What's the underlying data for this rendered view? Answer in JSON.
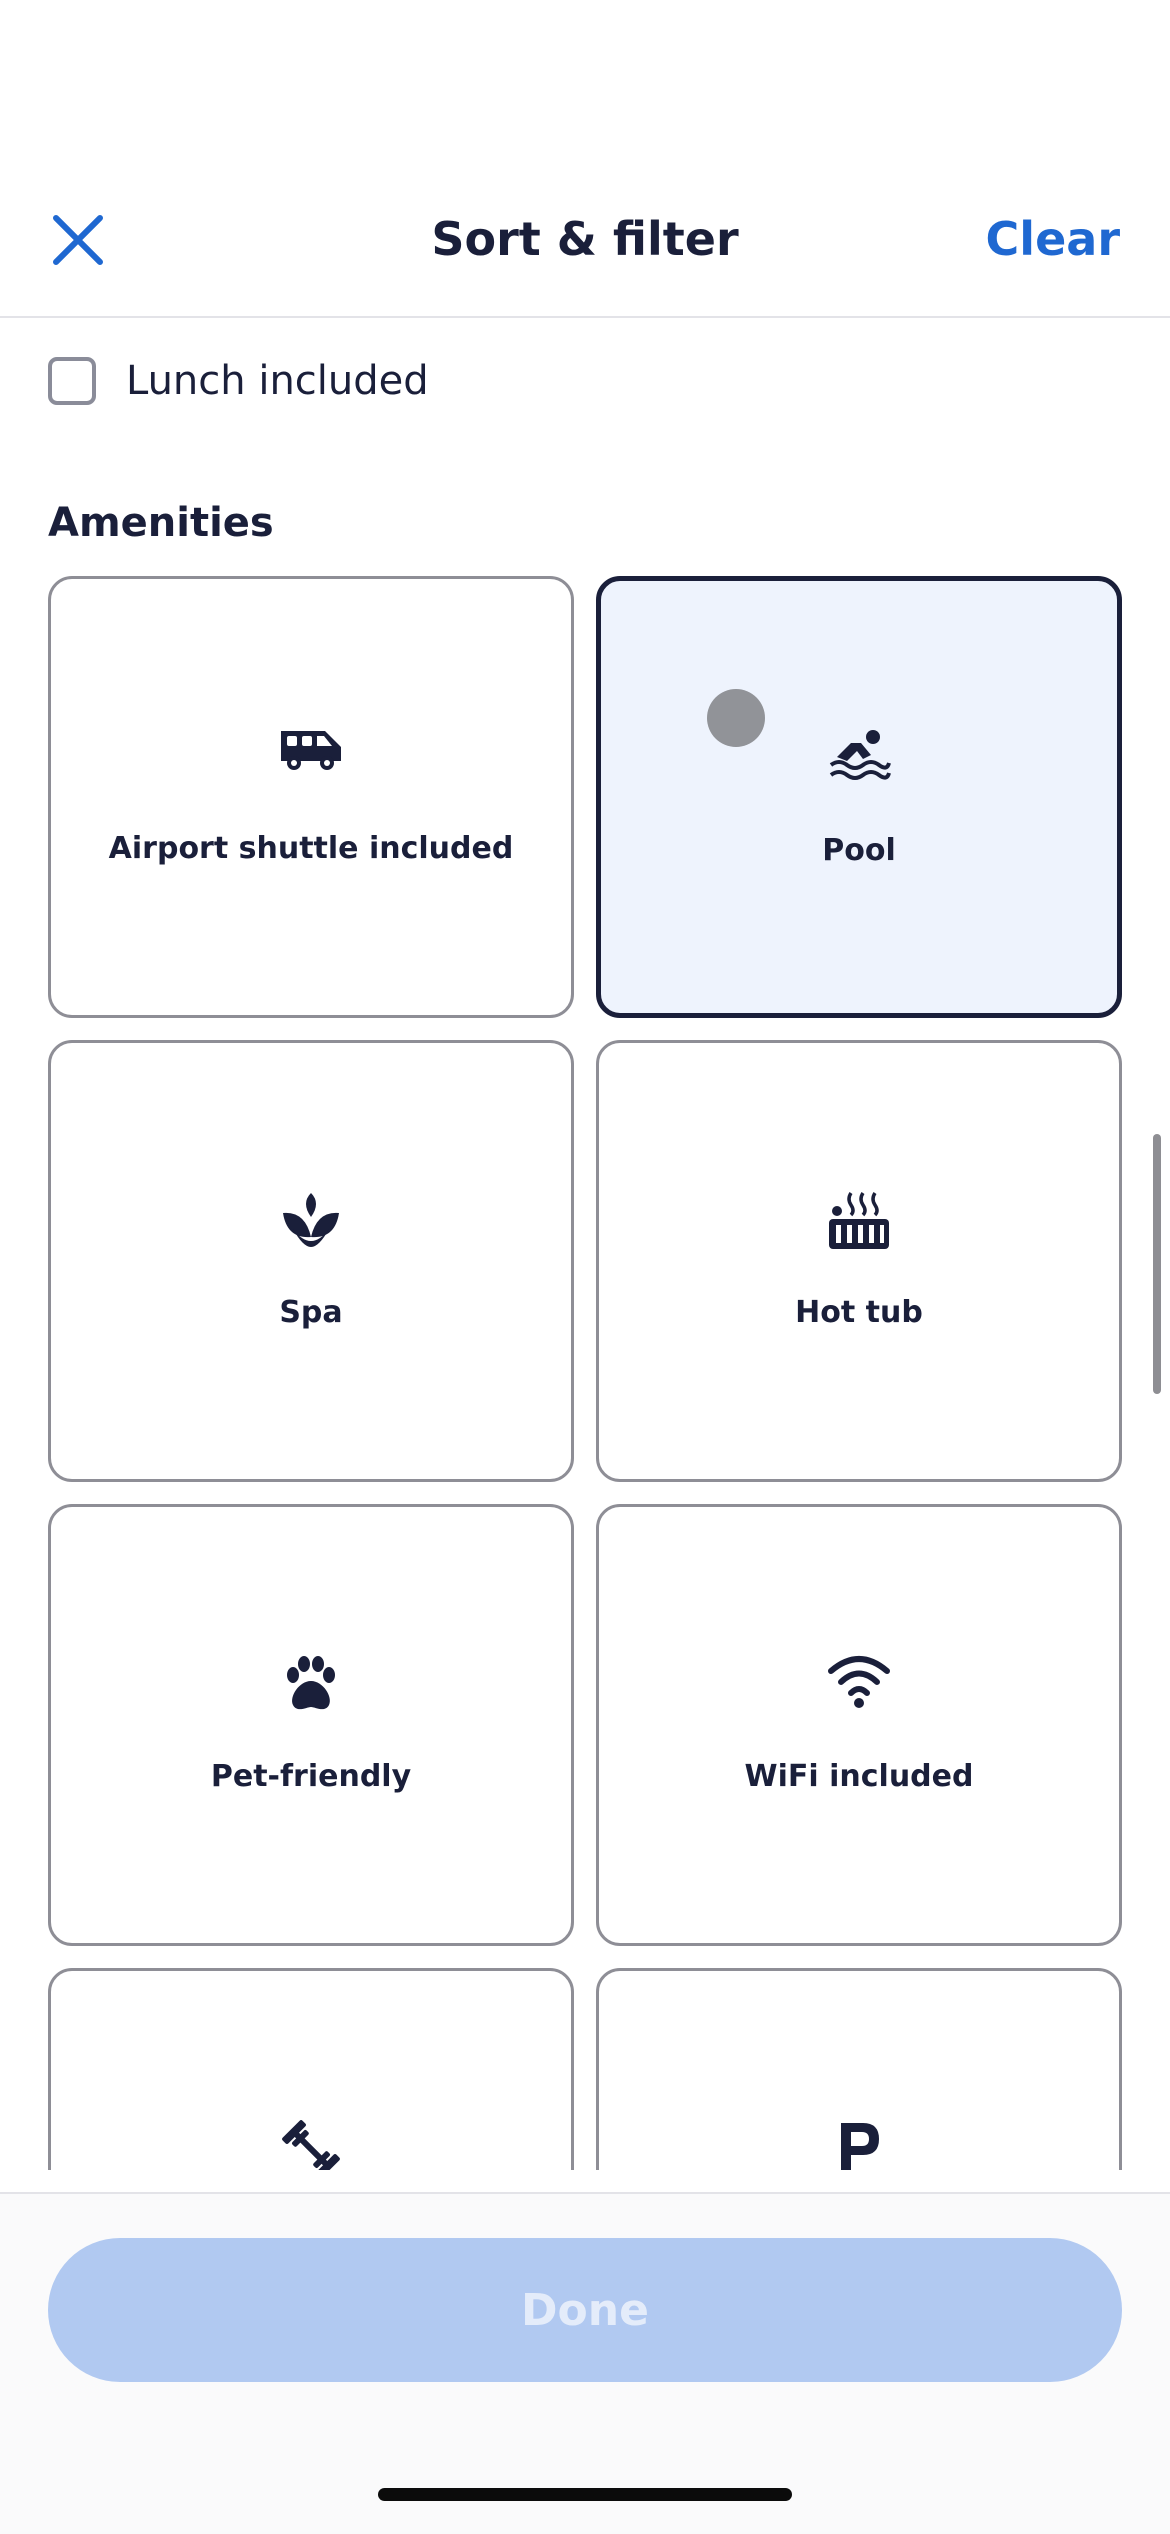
{
  "header": {
    "title": "Sort & filter",
    "clear_label": "Clear",
    "close_icon": "close-icon"
  },
  "filters": {
    "lunch_label": "Lunch included",
    "lunch_checked": false
  },
  "amenities": {
    "title": "Amenities",
    "items": [
      {
        "label": "Airport shuttle included",
        "icon": "shuttle-icon",
        "selected": false
      },
      {
        "label": "Pool",
        "icon": "pool-icon",
        "selected": true
      },
      {
        "label": "Spa",
        "icon": "spa-icon",
        "selected": false
      },
      {
        "label": "Hot tub",
        "icon": "hot-tub-icon",
        "selected": false
      },
      {
        "label": "Pet-friendly",
        "icon": "paw-icon",
        "selected": false
      },
      {
        "label": "WiFi included",
        "icon": "wifi-icon",
        "selected": false
      },
      {
        "label": "",
        "icon": "gym-icon",
        "selected": false
      },
      {
        "label": "",
        "icon": "parking-icon",
        "selected": false
      }
    ]
  },
  "footer": {
    "done_label": "Done"
  },
  "colors": {
    "accent": "#1f68d1",
    "text": "#1a1f3a",
    "selected_bg": "#eef3fd",
    "done_disabled_bg": "#b1c9f1",
    "done_disabled_text": "#e4ecfa"
  }
}
